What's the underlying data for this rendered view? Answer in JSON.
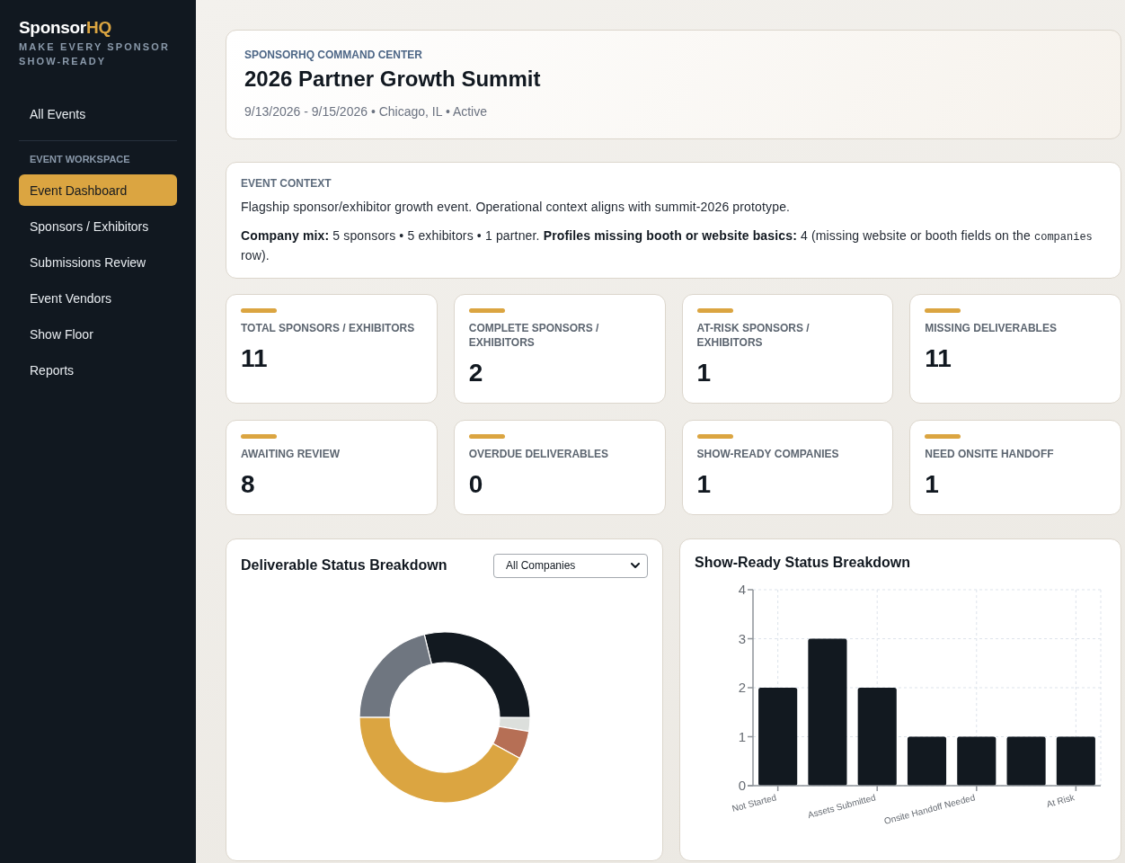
{
  "sidebar": {
    "brand": {
      "name": "Sponsor",
      "accent": "HQ"
    },
    "tagline": "MAKE EVERY SPONSOR SHOW-READY",
    "top_items": [
      {
        "label": "All Events",
        "selected": false
      }
    ],
    "section_label": "EVENT WORKSPACE",
    "items": [
      {
        "label": "Event Dashboard",
        "selected": true
      },
      {
        "label": "Sponsors / Exhibitors",
        "selected": false
      },
      {
        "label": "Submissions Review",
        "selected": false
      },
      {
        "label": "Event Vendors",
        "selected": false
      },
      {
        "label": "Show Floor",
        "selected": false
      },
      {
        "label": "Reports",
        "selected": false
      }
    ]
  },
  "header": {
    "eyebrow": "SPONSORHQ COMMAND CENTER",
    "title": "2026 Partner Growth Summit",
    "meta": "9/13/2026 - 9/15/2026 • Chicago, IL • Active"
  },
  "context": {
    "heading": "EVENT CONTEXT",
    "description": "Flagship sponsor/exhibitor growth event. Operational context aligns with summit-2026 prototype.",
    "summary": [
      {
        "kind": "text",
        "text": "**Company mix:** 5 sponsors • 5 exhibitors • 1 partner. **Profiles missing booth or website basics:** 4 (missing website or booth fields on the "
      },
      {
        "kind": "code",
        "text": "companies"
      },
      {
        "kind": "text",
        "text": " row)."
      }
    ]
  },
  "stats": [
    {
      "label": "TOTAL SPONSORS / EXHIBITORS",
      "value": "11"
    },
    {
      "label": "COMPLETE SPONSORS / EXHIBITORS",
      "value": "2"
    },
    {
      "label": "AT-RISK SPONSORS / EXHIBITORS",
      "value": "1"
    },
    {
      "label": "MISSING DELIVERABLES",
      "value": "11"
    },
    {
      "label": "AWAITING REVIEW",
      "value": "8"
    },
    {
      "label": "OVERDUE DELIVERABLES",
      "value": "0"
    },
    {
      "label": "SHOW-READY COMPANIES",
      "value": "1"
    },
    {
      "label": "NEED ONSITE HANDOFF",
      "value": "1"
    }
  ],
  "deliverables_chart": {
    "title": "Deliverable Status Breakdown",
    "filter": {
      "value": "All Companies"
    },
    "chart_data": {
      "type": "donut",
      "values": [
        28.9,
        2.6,
        5.3,
        42.1,
        21.1
      ],
      "colors": [
        "#121920",
        "#dcdfdc",
        "#b66f55",
        "#dba541",
        "#6f7680"
      ]
    }
  },
  "show_ready_chart": {
    "title": "Show-Ready Status Breakdown",
    "chart_data": {
      "type": "bar",
      "categories": [
        "Not Started",
        null,
        "Assets Submitted",
        null,
        "Onsite Handoff Needed",
        null,
        "At Risk"
      ],
      "values": [
        2,
        3,
        2,
        1,
        1,
        1,
        1
      ],
      "ylim": [
        0,
        4
      ],
      "yticks": [
        0,
        1,
        2,
        3,
        4
      ],
      "grid": true
    }
  }
}
